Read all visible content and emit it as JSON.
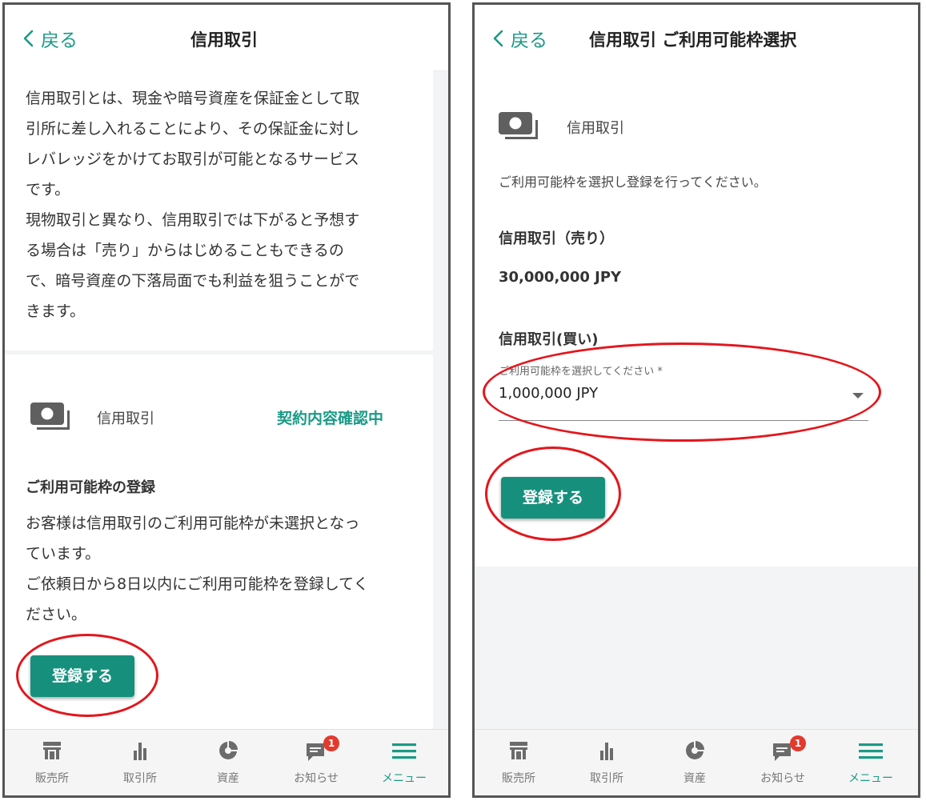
{
  "left": {
    "header": {
      "back_label": "戻る",
      "title": "信用取引"
    },
    "intro": [
      "信用取引とは、現金や暗号資産を保証金として取",
      "引所に差し入れることにより、その保証金に対し",
      "レバレッジをかけてお取引が可能となるサービス",
      "です。",
      "現物取引と異なり、信用取引では下がると予想す",
      "る場合は「売り」からはじめることもできるの",
      "で、暗号資産の下落局面でも利益を狙うことがで",
      "きます。"
    ],
    "service": {
      "label": "信用取引",
      "status": "契約内容確認中"
    },
    "registration": {
      "heading": "ご利用可能枠の登録",
      "body": [
        "お客様は信用取引のご利用可能枠が未選択となっ",
        "ています。",
        "ご依頼日から8日以内にご利用可能枠を登録してく",
        "ださい。"
      ],
      "button_label": "登録する"
    }
  },
  "right": {
    "header": {
      "back_label": "戻る",
      "title": "信用取引 ご利用可能枠選択"
    },
    "service_label": "信用取引",
    "instruction": "ご利用可能枠を選択し登録を行ってください。",
    "sell": {
      "heading": "信用取引（売り）",
      "amount": "30,000,000 JPY"
    },
    "buy": {
      "heading": "信用取引(買い)",
      "select_label": "ご利用可能枠を選択してください *",
      "selected_value": "1,000,000 JPY"
    },
    "button_label": "登録する"
  },
  "tabbar": {
    "items": [
      {
        "label": "販売所",
        "icon": "shop-icon"
      },
      {
        "label": "取引所",
        "icon": "bar-chart-icon"
      },
      {
        "label": "資産",
        "icon": "pie-chart-icon"
      },
      {
        "label": "お知らせ",
        "icon": "message-icon",
        "badge": "1"
      },
      {
        "label": "メニュー",
        "icon": "menu-icon",
        "active": true
      }
    ]
  },
  "colors": {
    "accent": "#1a9a86",
    "button": "#16907d",
    "badge": "#e33a2e",
    "annotation": "#e3161c"
  }
}
